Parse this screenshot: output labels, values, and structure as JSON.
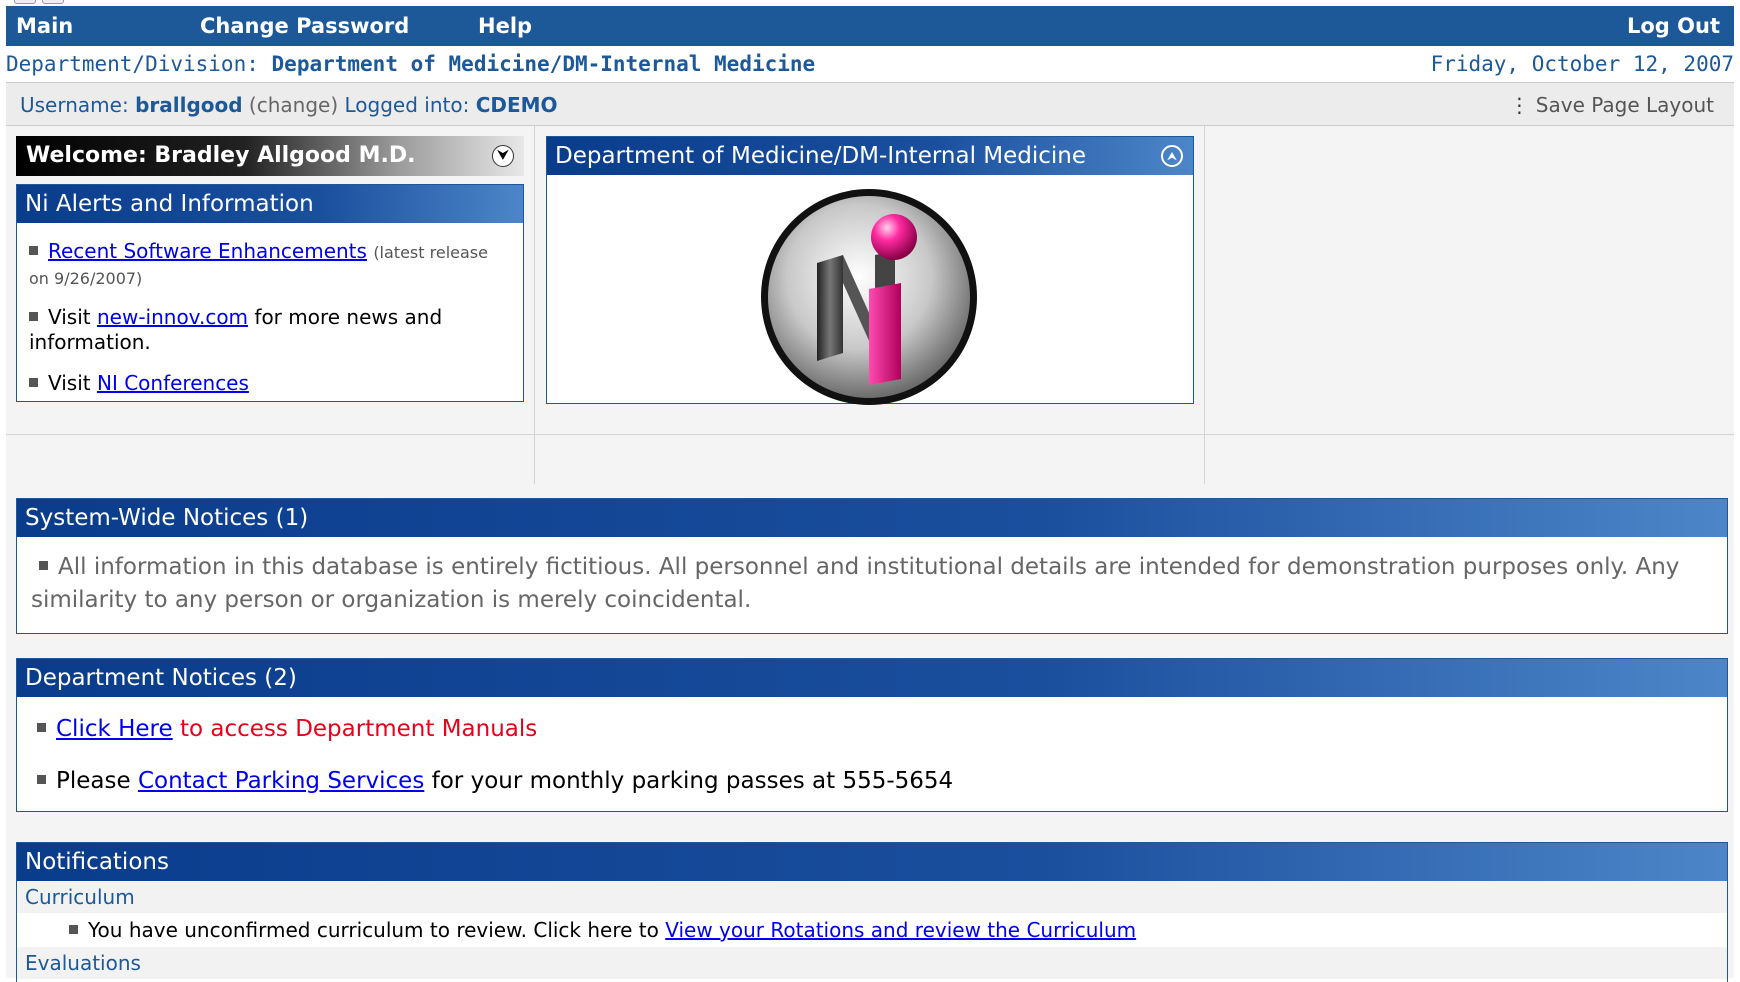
{
  "nav": {
    "main": "Main",
    "change_password": "Change Password",
    "help": "Help",
    "logout": "Log Out"
  },
  "dept_row": {
    "label": "Department/Division:",
    "value": "Department of Medicine/DM-Internal Medicine",
    "date": "Friday, October 12, 2007"
  },
  "user_bar": {
    "username_label": "Username:",
    "username": "brallgood",
    "change": "(change)",
    "logged_label": "Logged into:",
    "logged_value": "CDEMO",
    "save_layout": "Save Page Layout"
  },
  "welcome": {
    "text": "Welcome: Bradley Allgood M.D."
  },
  "alerts": {
    "title": "Ni Alerts and Information",
    "item1_link": "Recent Software Enhancements",
    "item1_note": "(latest release on 9/26/2007)",
    "item2_prefix": "Visit",
    "item2_link": "new-innov.com",
    "item2_suffix": "for more news and information.",
    "item3_prefix": "Visit",
    "item3_link": "NI Conferences"
  },
  "dept_panel": {
    "title": "Department of Medicine/DM-Internal Medicine"
  },
  "system_notices": {
    "title": "System-Wide Notices (1)",
    "text": "All information in this database is entirely fictitious. All personnel and institutional details are intended for demonstration purposes only. Any similarity to any person or organization is merely coincidental."
  },
  "dept_notices": {
    "title": "Department Notices (2)",
    "item1_link": "Click Here",
    "item1_suffix": "to access Department Manuals",
    "item2_prefix": "Please",
    "item2_link": "Contact Parking Services",
    "item2_suffix": "for your monthly parking passes at 555-5654"
  },
  "notifications": {
    "title": "Notifications",
    "section1": "Curriculum",
    "row1_prefix": "You have unconfirmed curriculum to review. Click here to",
    "row1_link": "View your Rotations and review the Curriculum",
    "section2": "Evaluations"
  },
  "colors": {
    "brand_blue": "#1d5898",
    "alert_red": "#e8001c",
    "logo_magenta": "#e0107a"
  }
}
